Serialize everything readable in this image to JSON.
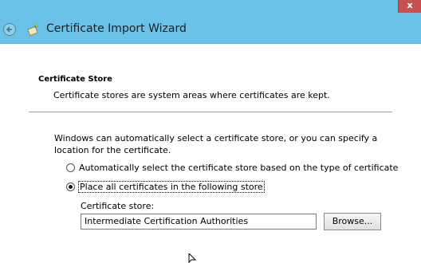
{
  "window": {
    "title": "Certificate Import Wizard",
    "close_glyph": "x",
    "accent_color": "#6bc2e8",
    "back_icon": "back-arrow-icon",
    "wizard_icon": "certificate-wizard-icon"
  },
  "section": {
    "heading": "Certificate Store",
    "description": "Certificate stores are system areas where certificates are kept."
  },
  "intro_text": "Windows can automatically select a certificate store, or you can specify a location for the certificate.",
  "options": [
    {
      "label": "Automatically select the certificate store based on the type of certificate",
      "selected": false
    },
    {
      "label": "Place all certificates in the following store",
      "selected": true
    }
  ],
  "store": {
    "label": "Certificate store:",
    "value": "Intermediate Certification Authorities",
    "browse_label": "Browse..."
  }
}
